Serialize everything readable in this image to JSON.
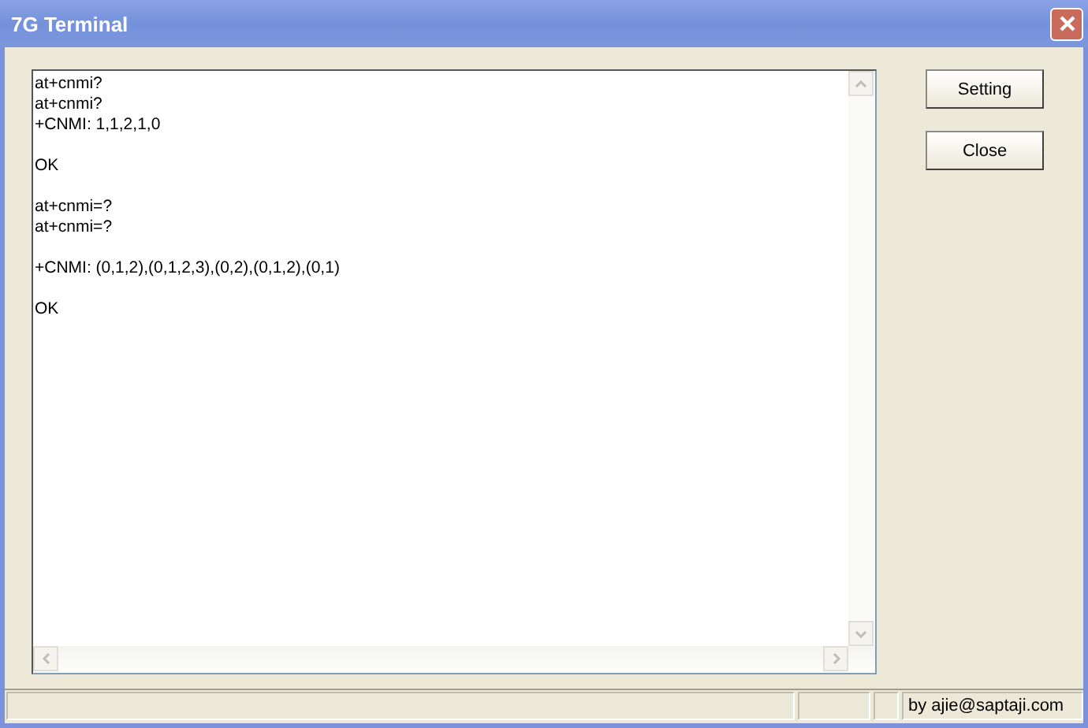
{
  "window": {
    "title": "7G Terminal"
  },
  "terminal": {
    "text": "at+cnmi?\nat+cnmi?\n+CNMI: 1,1,2,1,0\n\nOK\n\nat+cnmi=?\nat+cnmi=?\n\n+CNMI: (0,1,2),(0,1,2,3),(0,2),(0,1,2),(0,1)\n\nOK"
  },
  "buttons": [
    "Setting",
    "Close"
  ],
  "status_bar": {
    "credit": "by ajie@saptaji.com"
  }
}
